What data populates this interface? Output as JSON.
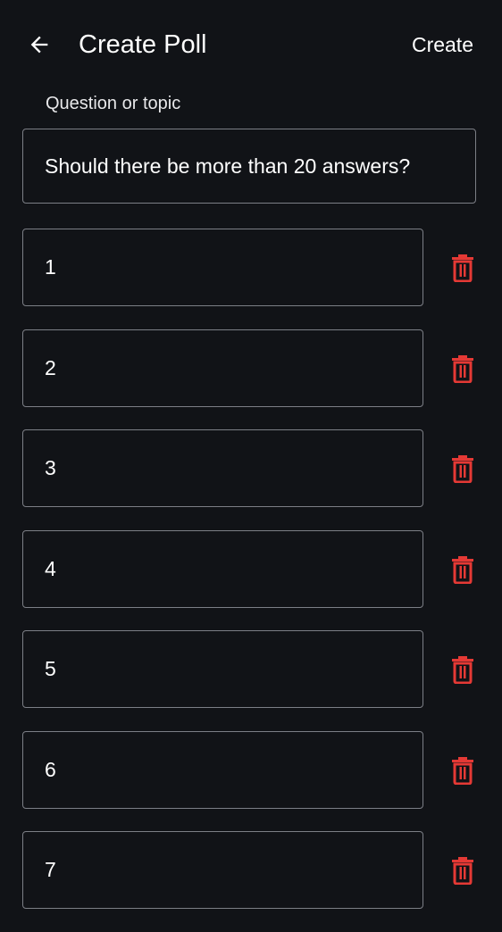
{
  "header": {
    "title": "Create Poll",
    "action_label": "Create",
    "back_icon": "arrow-left-icon"
  },
  "question": {
    "label": "Question or topic",
    "value": "Should there be more than 20 answers?"
  },
  "answers": [
    {
      "value": "1"
    },
    {
      "value": "2"
    },
    {
      "value": "3"
    },
    {
      "value": "4"
    },
    {
      "value": "5"
    },
    {
      "value": "6"
    },
    {
      "value": "7"
    }
  ],
  "delete_icon": "trash-icon",
  "colors": {
    "background": "#111317",
    "text": "#ffffff",
    "field_border": "#7c7f86",
    "delete": "#e53935"
  }
}
